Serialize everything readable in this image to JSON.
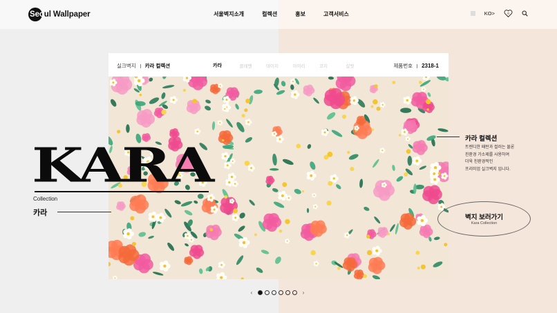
{
  "brand": {
    "name": "Seoul Wallpaper",
    "dark_part": "Seo",
    "light_part": "ul Wallpaper"
  },
  "nav": [
    "서울벽지소개",
    "컬렉션",
    "홍보",
    "고객서비스"
  ],
  "util": {
    "lang": "KO>",
    "wishlist_count": "0"
  },
  "breadcrumb": {
    "parent": "실크벽지",
    "current": "카라 컬렉션"
  },
  "tabs": [
    {
      "label": "카라",
      "active": true
    },
    {
      "label": "클레멘",
      "active": false
    },
    {
      "label": "데이지",
      "active": false
    },
    {
      "label": "아이리",
      "active": false
    },
    {
      "label": "코지",
      "active": false
    },
    {
      "label": "샬럿",
      "active": false
    }
  ],
  "product": {
    "label": "제품번호",
    "number": "2318-1"
  },
  "hero": {
    "title": "KARA",
    "subtitle": "Collection",
    "name_ko": "카라"
  },
  "description": {
    "title": "카라 컬렉션",
    "lines": [
      "트렌디한 패턴과 컬러는 물론",
      "친환경 가소제를 사용하여",
      "더욱 친환경적인",
      "프리미엄 실크벽지 입니다."
    ]
  },
  "view_button": {
    "label": "벽지 보러가기",
    "sub": "Kara Collection"
  },
  "pager": {
    "prev": "‹",
    "next": "›",
    "total": 6,
    "current": 1
  },
  "colors": {
    "left_bg": "#efefef",
    "right_bg": "#f5e6dc",
    "accent": "#111111",
    "pattern_bg": "#f2e6d6"
  }
}
